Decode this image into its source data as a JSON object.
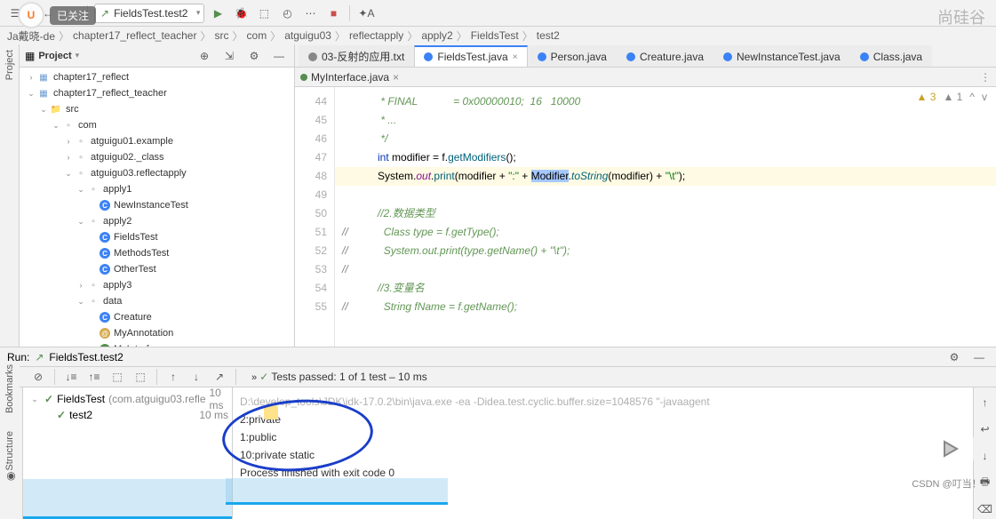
{
  "watermarks": {
    "followed": "已关注",
    "channel": "尚硅谷",
    "csdn": "CSDN @叮当！*"
  },
  "toolbar": {
    "run_config": "FieldsTest.test2"
  },
  "breadcrumb": [
    "Ja戴晓-de",
    "chapter17_reflect_teacher",
    "src",
    "com",
    "atguigu03",
    "reflectapply",
    "apply2",
    "FieldsTest",
    "test2"
  ],
  "project": {
    "title": "Project",
    "nodes": [
      {
        "d": 0,
        "tw": "›",
        "ico": "module",
        "label": "chapter17_reflect"
      },
      {
        "d": 0,
        "tw": "⌄",
        "ico": "module",
        "label": "chapter17_reflect_teacher"
      },
      {
        "d": 1,
        "tw": "⌄",
        "ico": "folder",
        "label": "src"
      },
      {
        "d": 2,
        "tw": "⌄",
        "ico": "pkg",
        "label": "com"
      },
      {
        "d": 3,
        "tw": "›",
        "ico": "pkg",
        "label": "atguigu01.example"
      },
      {
        "d": 3,
        "tw": "›",
        "ico": "pkg",
        "label": "atguigu02._class"
      },
      {
        "d": 3,
        "tw": "⌄",
        "ico": "pkg",
        "label": "atguigu03.reflectapply"
      },
      {
        "d": 4,
        "tw": "⌄",
        "ico": "pkg",
        "label": "apply1"
      },
      {
        "d": 5,
        "tw": "",
        "ico": "class",
        "label": "NewInstanceTest"
      },
      {
        "d": 4,
        "tw": "⌄",
        "ico": "pkg",
        "label": "apply2"
      },
      {
        "d": 5,
        "tw": "",
        "ico": "class",
        "label": "FieldsTest"
      },
      {
        "d": 5,
        "tw": "",
        "ico": "class",
        "label": "MethodsTest"
      },
      {
        "d": 5,
        "tw": "",
        "ico": "class",
        "label": "OtherTest"
      },
      {
        "d": 4,
        "tw": "›",
        "ico": "pkg",
        "label": "apply3"
      },
      {
        "d": 4,
        "tw": "⌄",
        "ico": "pkg",
        "label": "data"
      },
      {
        "d": 5,
        "tw": "",
        "ico": "class",
        "label": "Creature"
      },
      {
        "d": 5,
        "tw": "",
        "ico": "ann",
        "label": "MyAnnotation"
      },
      {
        "d": 5,
        "tw": "",
        "ico": "int",
        "label": "MyInterface"
      }
    ]
  },
  "tabs": [
    {
      "label": "03-反射的应用.txt",
      "ico": "#888",
      "active": false
    },
    {
      "label": "FieldsTest.java",
      "ico": "#3b82f6",
      "active": true
    },
    {
      "label": "Person.java",
      "ico": "#3b82f6",
      "active": false
    },
    {
      "label": "Creature.java",
      "ico": "#3b82f6",
      "active": false
    },
    {
      "label": "NewInstanceTest.java",
      "ico": "#3b82f6",
      "active": false
    },
    {
      "label": "Class.java",
      "ico": "#3b82f6",
      "active": false
    }
  ],
  "subtabs": {
    "left": "MyInterface.java"
  },
  "code": {
    "start": 44,
    "lines": [
      {
        "n": 44,
        "html": "<span class='c-doc'>             * FINAL            = 0x00000010;  16   10000</span>"
      },
      {
        "n": 45,
        "html": "<span class='c-doc'>             * ...</span>"
      },
      {
        "n": 46,
        "html": "<span class='c-doc'>             */</span>"
      },
      {
        "n": 47,
        "html": "            <span class='c-kw'>int</span> modifier = f.<span class='c-meth'>getModifiers</span>();"
      },
      {
        "n": 48,
        "hl": true,
        "html": "            System.<span class='c-field'>out</span>.<span class='c-meth'>print</span>(modifier + <span class='c-str'>\":\"</span> + <span class='sel'>Modifier</span>.<span class='c-meth c-doc' style='font-style:italic'>toString</span>(modifier) + <span class='c-str'>\"\\t\"</span>);"
      },
      {
        "n": 49,
        "html": ""
      },
      {
        "n": 50,
        "html": "            <span class='c-doc'>//2.数据类型</span>"
      },
      {
        "n": 51,
        "html": "<span class='c-com'>//</span>            <span class='c-doc'>Class type = f.getType();</span>"
      },
      {
        "n": 52,
        "html": "<span class='c-com'>//</span>            <span class='c-doc'>System.out.print(type.getName() + \"\\t\");</span>"
      },
      {
        "n": 53,
        "html": "<span class='c-com'>//</span>"
      },
      {
        "n": 54,
        "html": "            <span class='c-doc'>//3.变量名</span>"
      },
      {
        "n": 55,
        "html": "<span class='c-com'>//</span>            <span class='c-doc'>String fName = f.getName();</span>"
      }
    ],
    "badges": {
      "warn": "3",
      "hint": "1"
    }
  },
  "run": {
    "label": "Run:",
    "config": "FieldsTest.test2",
    "status": "Tests passed: 1 of 1 test – 10 ms",
    "tree": [
      {
        "d": 0,
        "ok": true,
        "label": "FieldsTest",
        "hint": "(com.atguigu03.refle",
        "time": "10 ms"
      },
      {
        "d": 1,
        "ok": true,
        "label": "test2",
        "time": "10 ms"
      }
    ],
    "console": [
      "D:\\develop_tools\\JDK\\jdk-17.0.2\\bin\\java.exe -ea -Didea.test.cyclic.buffer.size=1048576 \"-javaagent",
      "2:private",
      "1:public",
      "10:private static",
      "",
      "Process finished with exit code 0"
    ]
  },
  "sidebar_labels": {
    "project": "Project",
    "bookmarks": "Bookmarks",
    "structure": "Structure"
  }
}
